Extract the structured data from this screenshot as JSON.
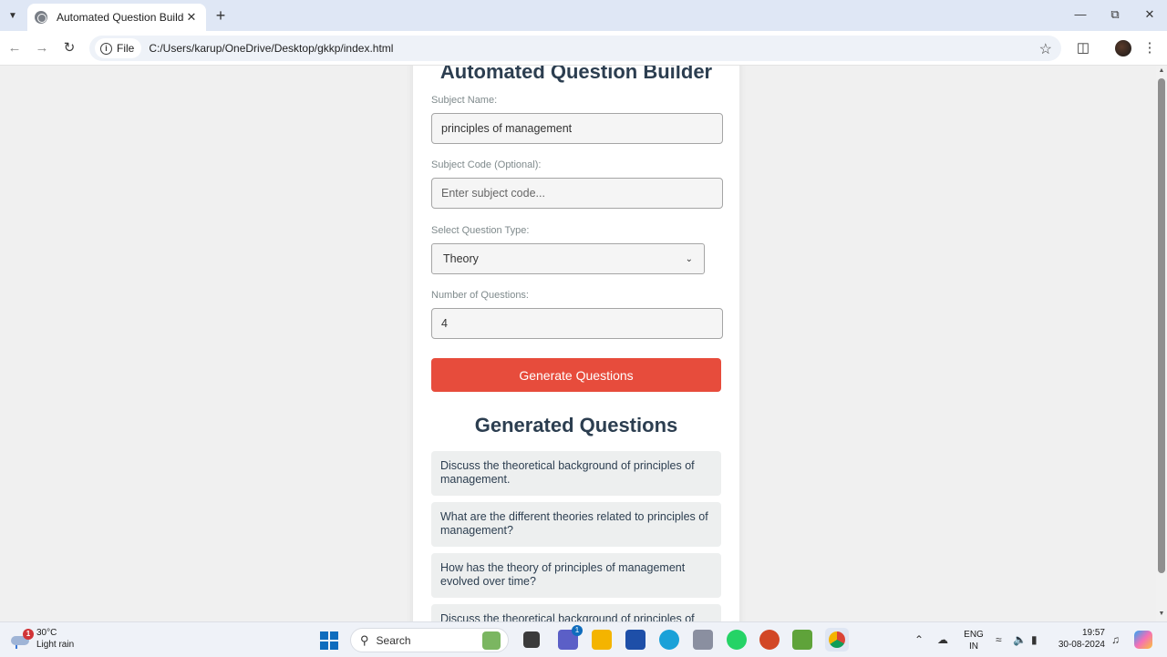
{
  "browser": {
    "tab_title": "Automated Question Builder",
    "chip_label": "File",
    "url": "C:/Users/karup/OneDrive/Desktop/gkkp/index.html"
  },
  "app": {
    "title": "Automated Question Builder",
    "subject_name_label": "Subject Name:",
    "subject_name_value": "principles of management",
    "subject_code_label": "Subject Code (Optional):",
    "subject_code_placeholder": "Enter subject code...",
    "question_type_label": "Select Question Type:",
    "question_type_value": "Theory",
    "num_questions_label": "Number of Questions:",
    "num_questions_value": "4",
    "generate_button": "Generate Questions",
    "results_heading": "Generated Questions",
    "questions": [
      "Discuss the theoretical background of principles of management.",
      "What are the different theories related to principles of management?",
      "How has the theory of principles of management evolved over time?",
      "Discuss the theoretical background of principles of management."
    ]
  },
  "taskbar": {
    "weather_badge": "1",
    "temperature": "30°C",
    "condition": "Light rain",
    "search_label": "Search",
    "teams_badge": "1",
    "lang_top": "ENG",
    "lang_bottom": "IN",
    "time": "19:57",
    "date": "30-08-2024"
  },
  "colors": {
    "accent_button": "#e74c3c",
    "heading": "#2c3e50",
    "tab_strip": "#dfe7f5"
  }
}
